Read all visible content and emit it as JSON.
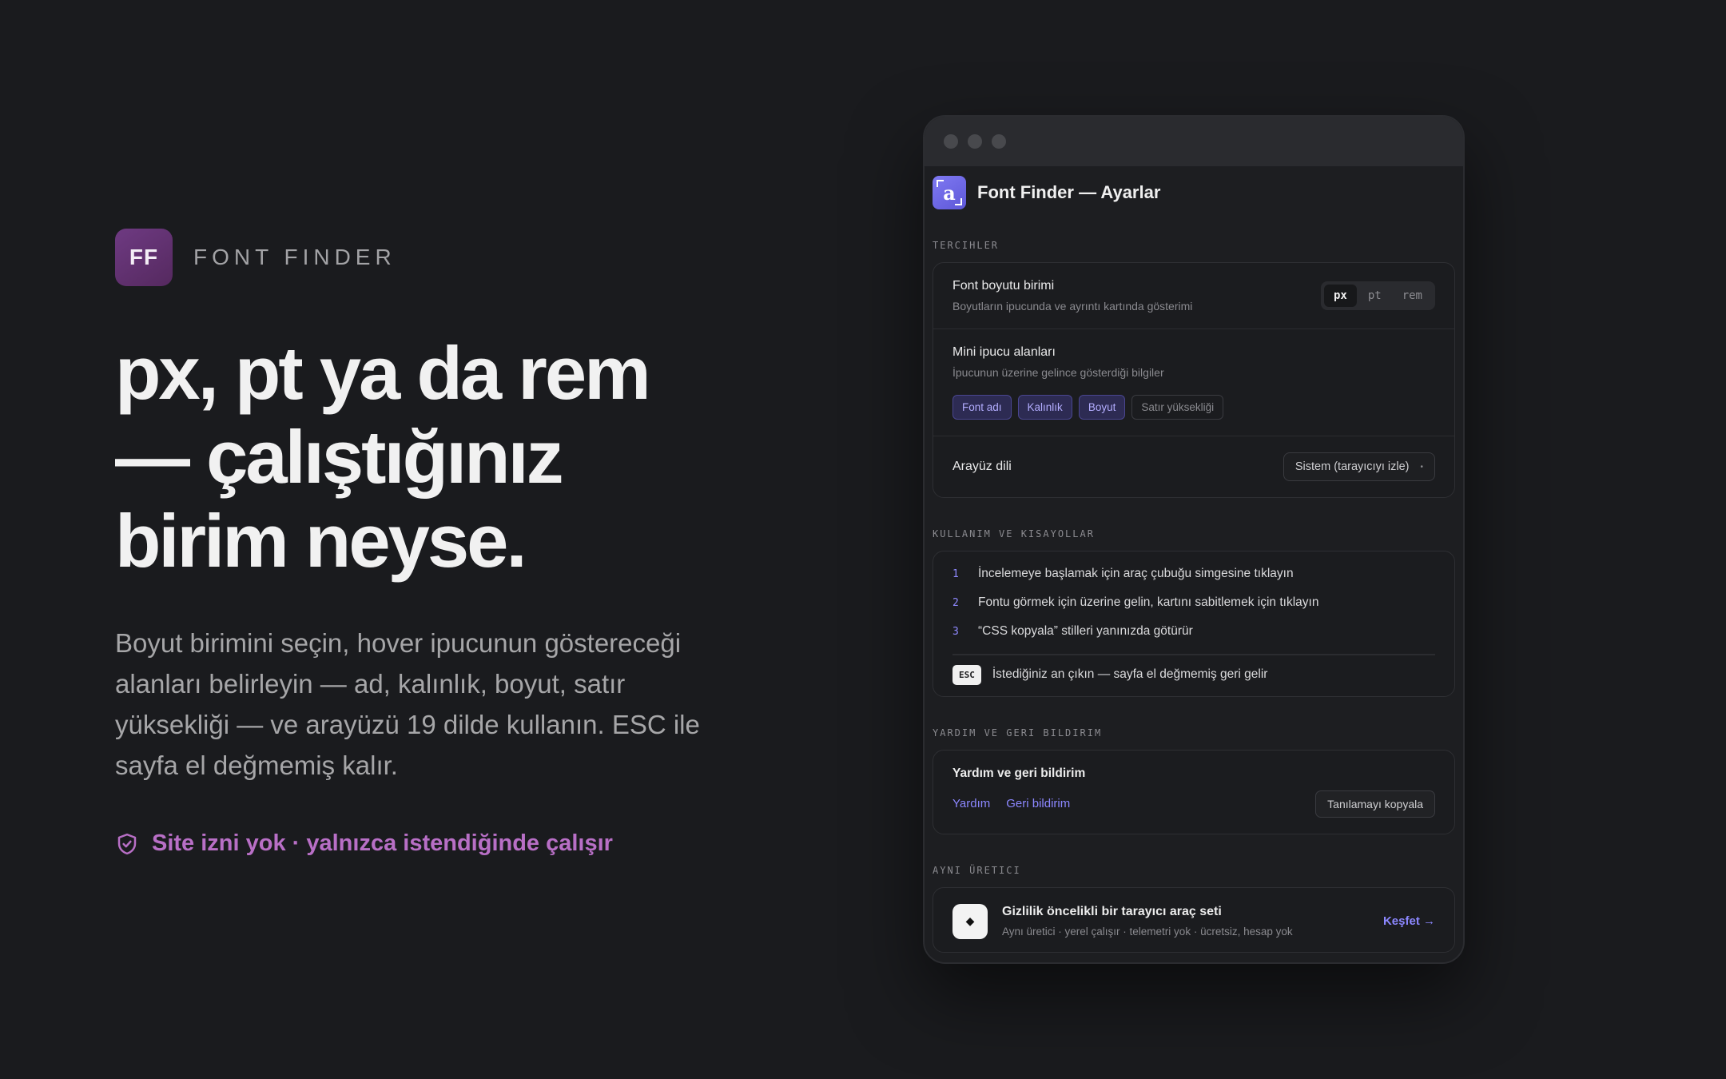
{
  "brand": {
    "logo_text": "FF",
    "name": "FONT FINDER"
  },
  "hero": {
    "headline": [
      "px, pt ya da rem",
      "— çalıştığınız",
      "birim neyse."
    ],
    "lede": "Boyut birimini seçin, hover ipucunun göstereceği alanları belirleyin — ad, kalınlık, boyut, satır yüksekliği — ve arayüzü 19 dilde kullanın. ESC ile sayfa el değmemiş kalır.",
    "permission_note": "Site izni yok · yalnızca istendiğinde çalışır"
  },
  "window": {
    "app_icon_letter": "a",
    "title": "Font Finder — Ayarlar",
    "preferences": {
      "section_label": "TERCIHLER",
      "unit": {
        "title": "Font boyutu birimi",
        "desc": "Boyutların ipucunda ve ayrıntı kartında gösterimi",
        "options": [
          "px",
          "pt",
          "rem"
        ],
        "selected": "px"
      },
      "tooltip_fields": {
        "title": "Mini ipucu alanları",
        "desc": "İpucunun üzerine gelince gösterdiği bilgiler",
        "chips": [
          {
            "label": "Font adı",
            "active": true
          },
          {
            "label": "Kalınlık",
            "active": true
          },
          {
            "label": "Boyut",
            "active": true
          },
          {
            "label": "Satır yüksekliği",
            "active": false
          }
        ]
      },
      "language": {
        "title": "Arayüz dili",
        "value": "Sistem (tarayıcıyı izle)"
      }
    },
    "usage": {
      "section_label": "KULLANIM VE KISAYOLLAR",
      "steps": [
        {
          "num": "1",
          "text": "İncelemeye başlamak için araç çubuğu simgesine tıklayın"
        },
        {
          "num": "2",
          "text": "Fontu görmek için üzerine gelin, kartını sabitlemek için tıklayın"
        },
        {
          "num": "3",
          "text": "“CSS kopyala” stilleri yanınızda götürür"
        }
      ],
      "esc_key": "ESC",
      "esc_text": "İstediğiniz an çıkın — sayfa el değmemiş geri gelir"
    },
    "help": {
      "section_label": "YARDIM VE GERI BILDIRIM",
      "title": "Yardım ve geri bildirim",
      "links": [
        "Yardım",
        "Geri bildirim"
      ],
      "copy_button": "Tanılamayı kopyala"
    },
    "maker": {
      "section_label": "AYNI ÜRETICI",
      "icon": "◆",
      "title": "Gizlilik öncelikli bir tarayıcı araç seti",
      "subtitle": "Aynı üretici · yerel çalışır · telemetri yok · ücretsiz, hesap yok",
      "cta": "Keşfet →"
    }
  }
}
